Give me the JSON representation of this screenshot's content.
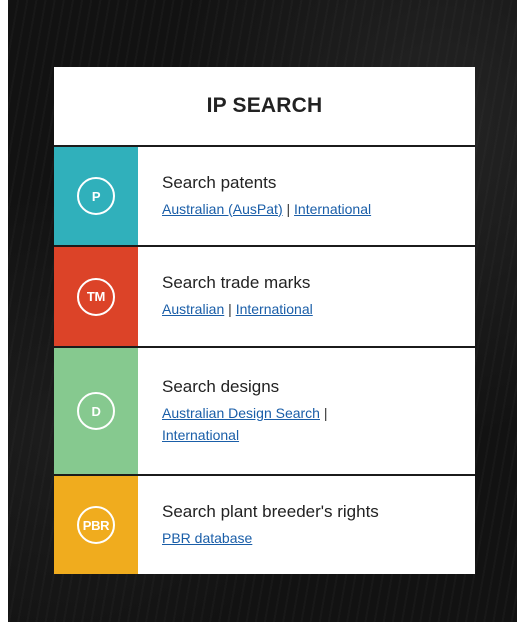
{
  "panel": {
    "title": "IP SEARCH",
    "rows": [
      {
        "badge": "P",
        "badge_icon": "patent-icon",
        "color": "#30b0bb",
        "title": "Search patents",
        "links": [
          "Australian (AusPat)",
          "International"
        ],
        "separator": "|"
      },
      {
        "badge": "TM",
        "badge_icon": "trade-mark-icon",
        "color": "#dc4328",
        "title": "Search trade marks",
        "links": [
          "Australian",
          "International"
        ],
        "separator": "|"
      },
      {
        "badge": "D",
        "badge_icon": "design-icon",
        "color": "#86c98f",
        "title": "Search designs",
        "links": [
          "Australian Design Search",
          "International"
        ],
        "separator": "|"
      },
      {
        "badge": "PBR",
        "badge_icon": "plant-breeders-rights-icon",
        "color": "#f0ac1e",
        "title": "Search plant breeder's rights",
        "links": [
          "PBR database"
        ]
      }
    ]
  }
}
